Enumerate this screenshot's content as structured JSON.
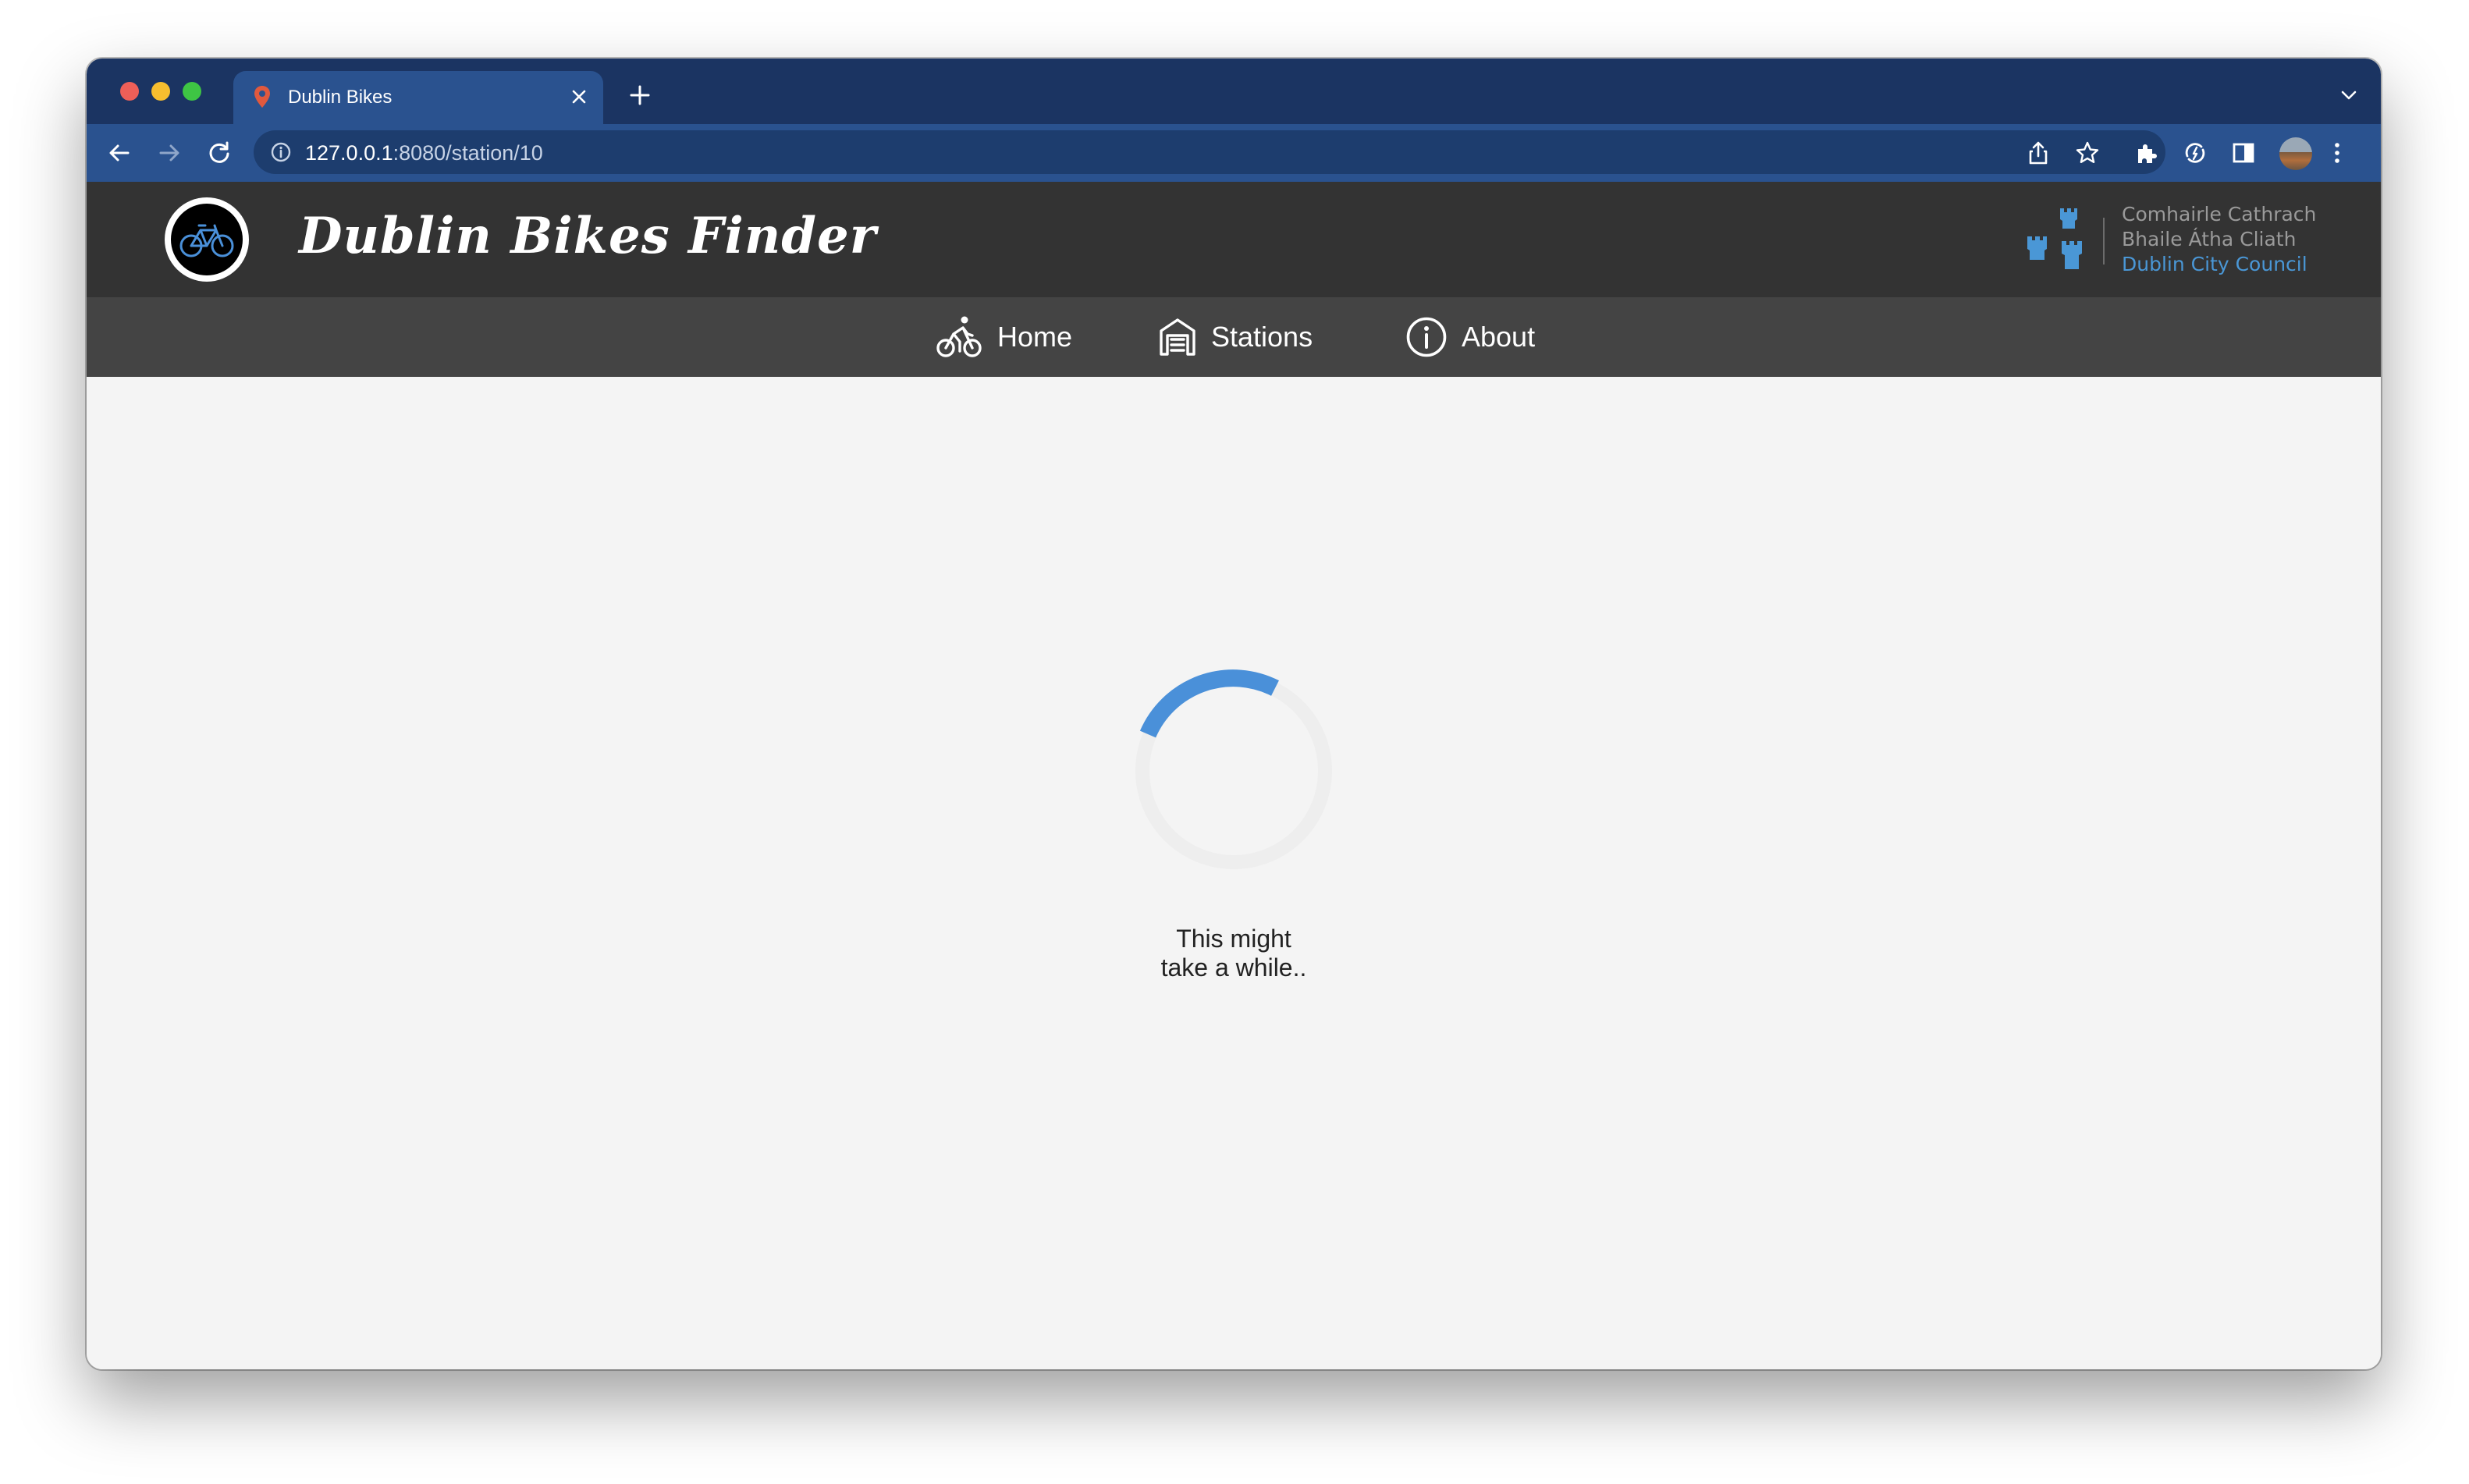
{
  "browser": {
    "tab": {
      "title": "Dublin Bikes"
    },
    "address_bar": {
      "host": "127.0.0.1",
      "path": ":8080/station/10"
    },
    "colors": {
      "tab_strip": "#1b3462",
      "toolbar": "#2a528f"
    }
  },
  "app": {
    "title": "Dublin Bikes Finder",
    "council": {
      "line1": "Comhairle Cathrach",
      "line2": "Bhaile Átha Cliath",
      "line3": "Dublin City Council"
    },
    "nav": [
      {
        "label": "Home",
        "icon": "cyclist-icon"
      },
      {
        "label": "Stations",
        "icon": "garage-icon"
      },
      {
        "label": "About",
        "icon": "info-icon"
      }
    ],
    "loading": {
      "message": "This might take a while..",
      "spinner_color": "#4a90d9"
    },
    "colors": {
      "header": "#333333",
      "navbar": "#444444",
      "content": "#f4f4f4",
      "council_accent": "#4a97d6"
    }
  }
}
